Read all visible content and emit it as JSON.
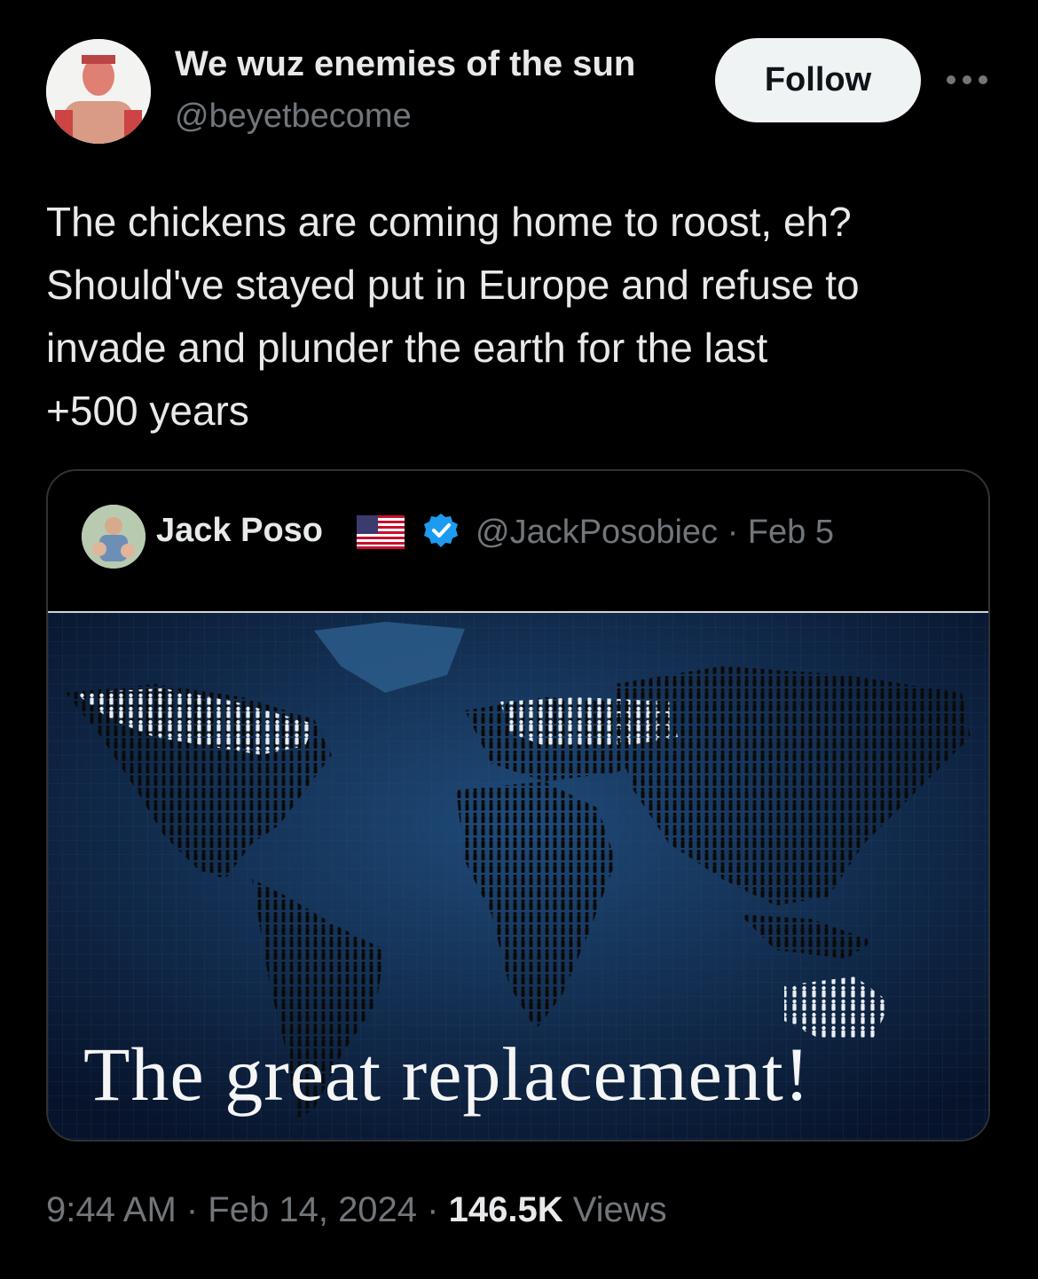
{
  "author": {
    "display_name": "We wuz enemies of the sun",
    "handle": "@beyetbecome"
  },
  "follow_label": "Follow",
  "tweet_lines": [
    "The chickens are coming home to roost, eh?",
    "Should've stayed put in Europe and refuse to",
    "invade and plunder the earth for the last",
    "+500 years"
  ],
  "quote": {
    "display_name": "Jack Poso",
    "handle_date": "@JackPosobiec · Feb 5",
    "image_caption": "The great replacement!"
  },
  "meta": {
    "timestamp": "9:44 AM · Feb 14, 2024 · ",
    "views_count": "146.5K",
    "views_label": " Views"
  },
  "colors": {
    "background": "#000000",
    "text_primary": "#e7e9ea",
    "text_secondary": "#71767b",
    "verified_blue": "#1d9bf0",
    "border": "#2f3336"
  }
}
